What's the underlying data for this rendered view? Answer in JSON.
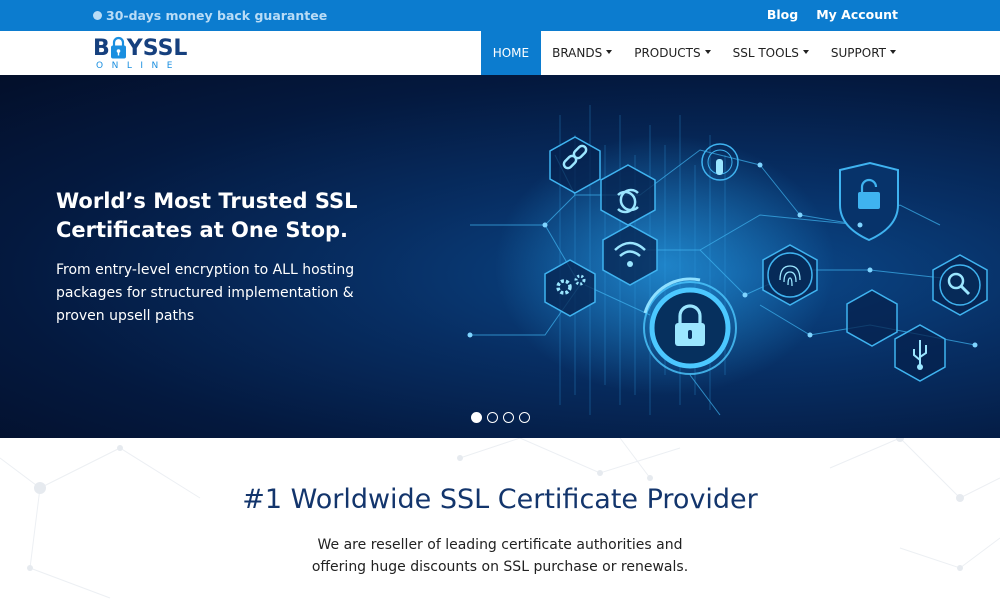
{
  "topbar": {
    "guarantee": "30-days money back guarantee",
    "blog": "Blog",
    "account": "My Account"
  },
  "logo": {
    "word": "BUYSSL",
    "sub": "ONLINE"
  },
  "nav": {
    "home": "HOME",
    "brands": "BRANDS",
    "products": "PRODUCTS",
    "ssl_tools": "SSL TOOLS",
    "support": "SUPPORT"
  },
  "hero": {
    "title": "World’s Most Trusted SSL Certificates at One Stop.",
    "subtitle": "From entry-level encryption to ALL hosting packages for structured implementation & proven upsell paths",
    "slide_count": 4,
    "active_slide": 1
  },
  "intro": {
    "heading": "#1 Worldwide SSL Certificate Provider",
    "text": "We are reseller of leading certificate authorities and offering huge discounts on SSL purchase or renewals."
  },
  "colors": {
    "brand_blue": "#0c7ccf",
    "navy": "#13356c",
    "hero_dark": "#04193f"
  }
}
